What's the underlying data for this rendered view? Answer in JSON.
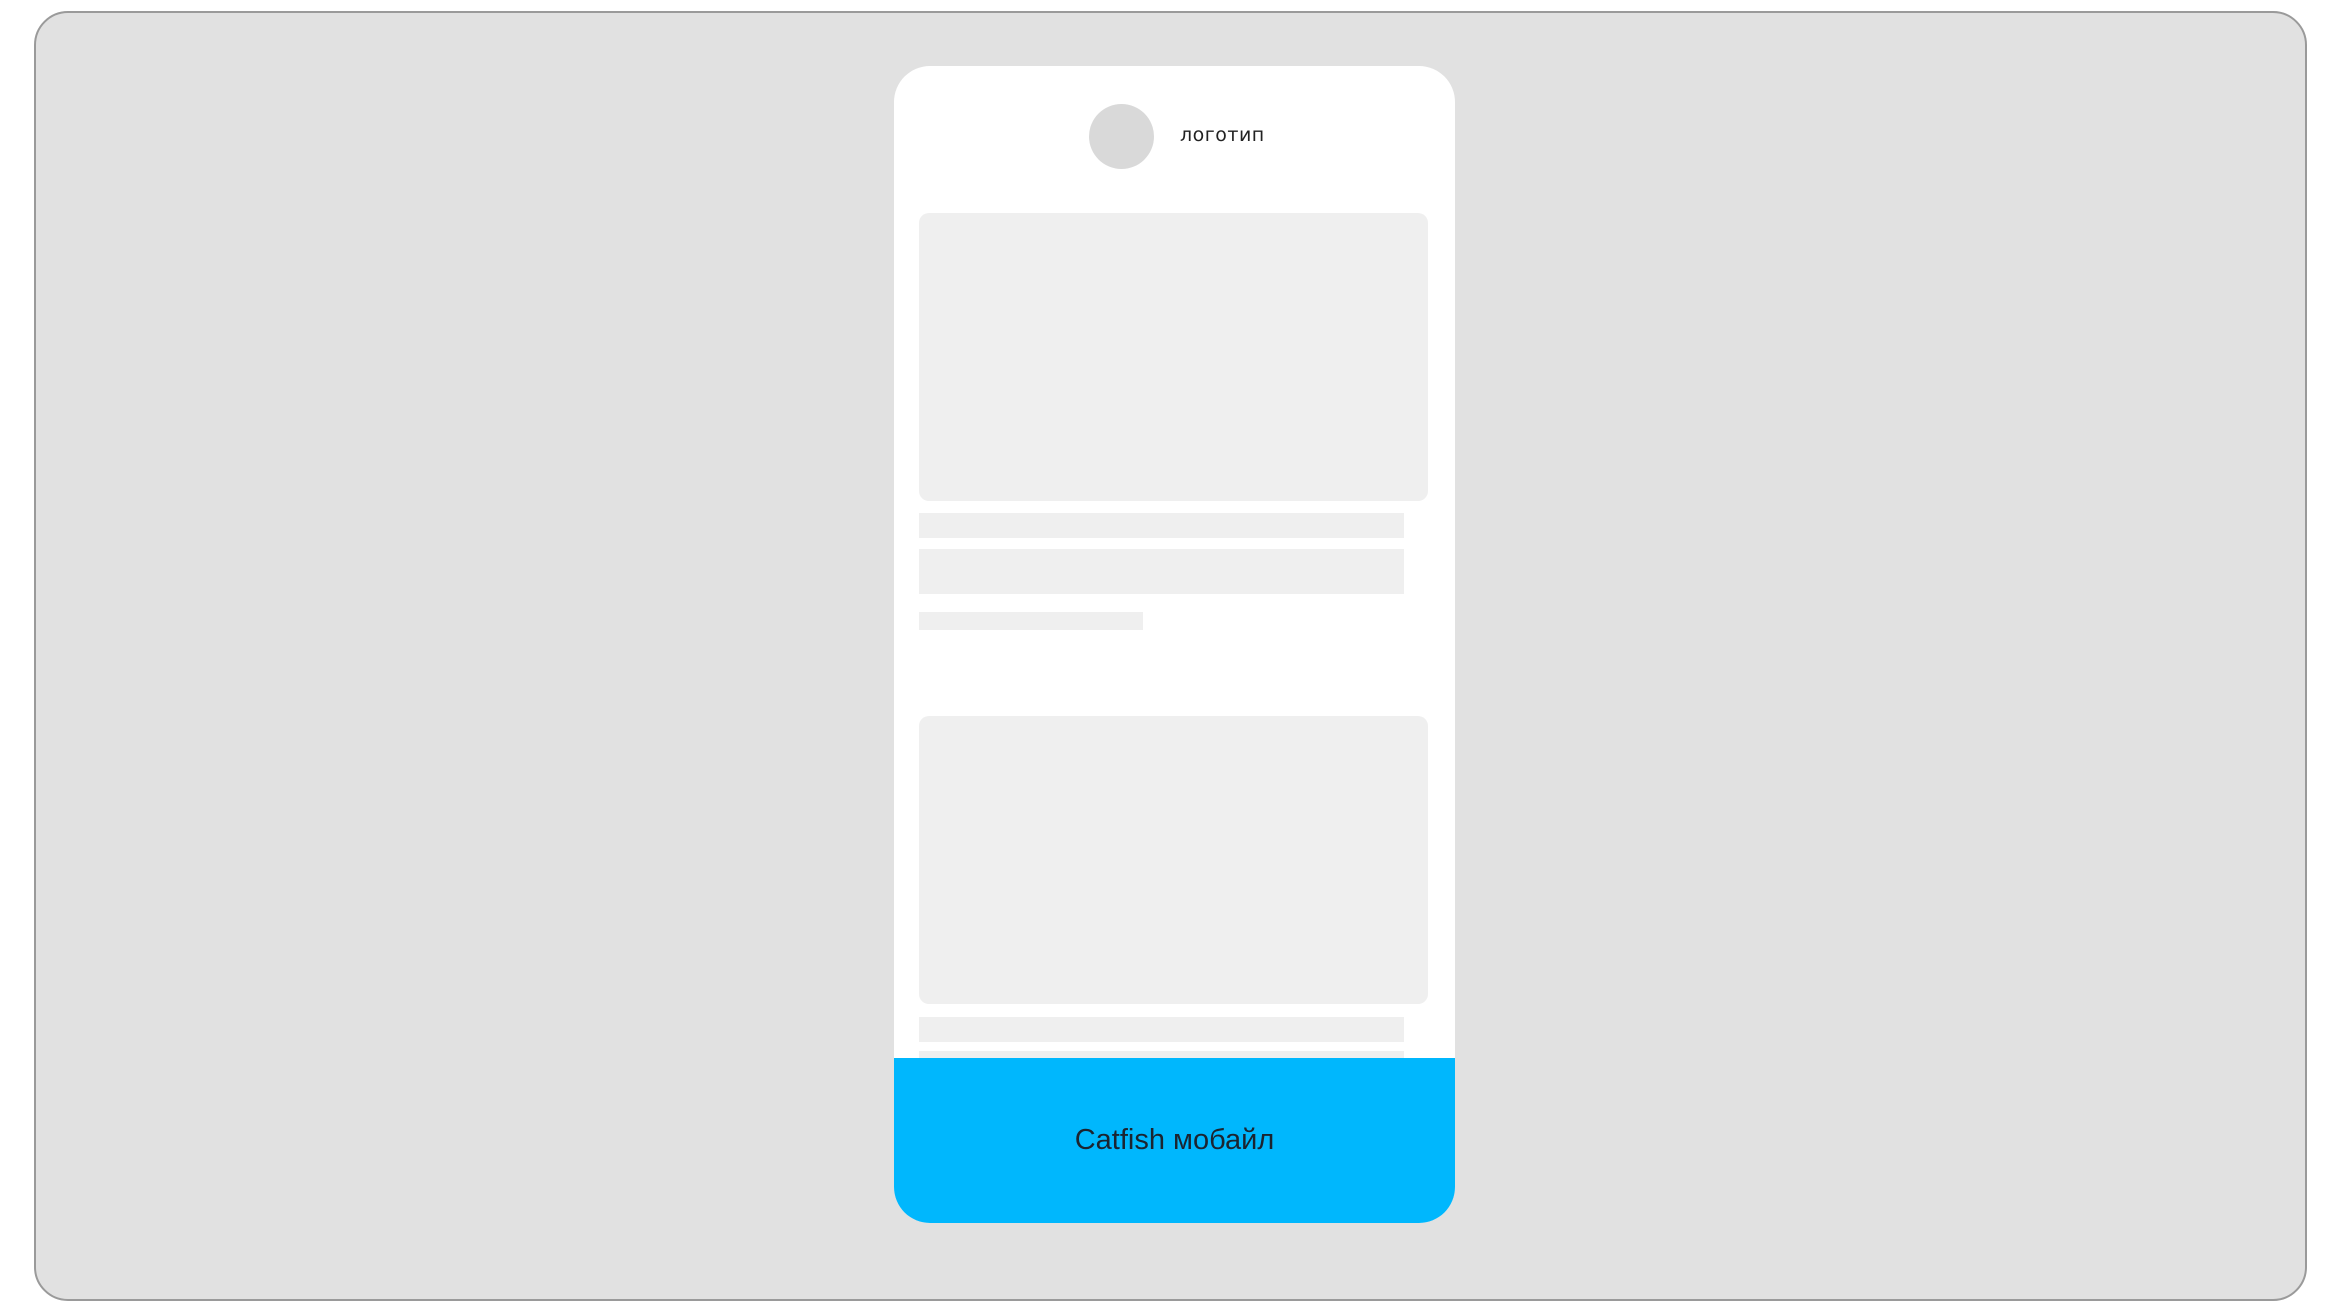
{
  "header": {
    "logo_label": "логотип"
  },
  "banner": {
    "label": "Catfish мобайл",
    "background_color": "#00b7fd"
  },
  "colors": {
    "canvas_background": "#e1e1e1",
    "phone_background": "#ffffff",
    "placeholder": "#efefef",
    "logo_placeholder": "#d9d9d9"
  }
}
